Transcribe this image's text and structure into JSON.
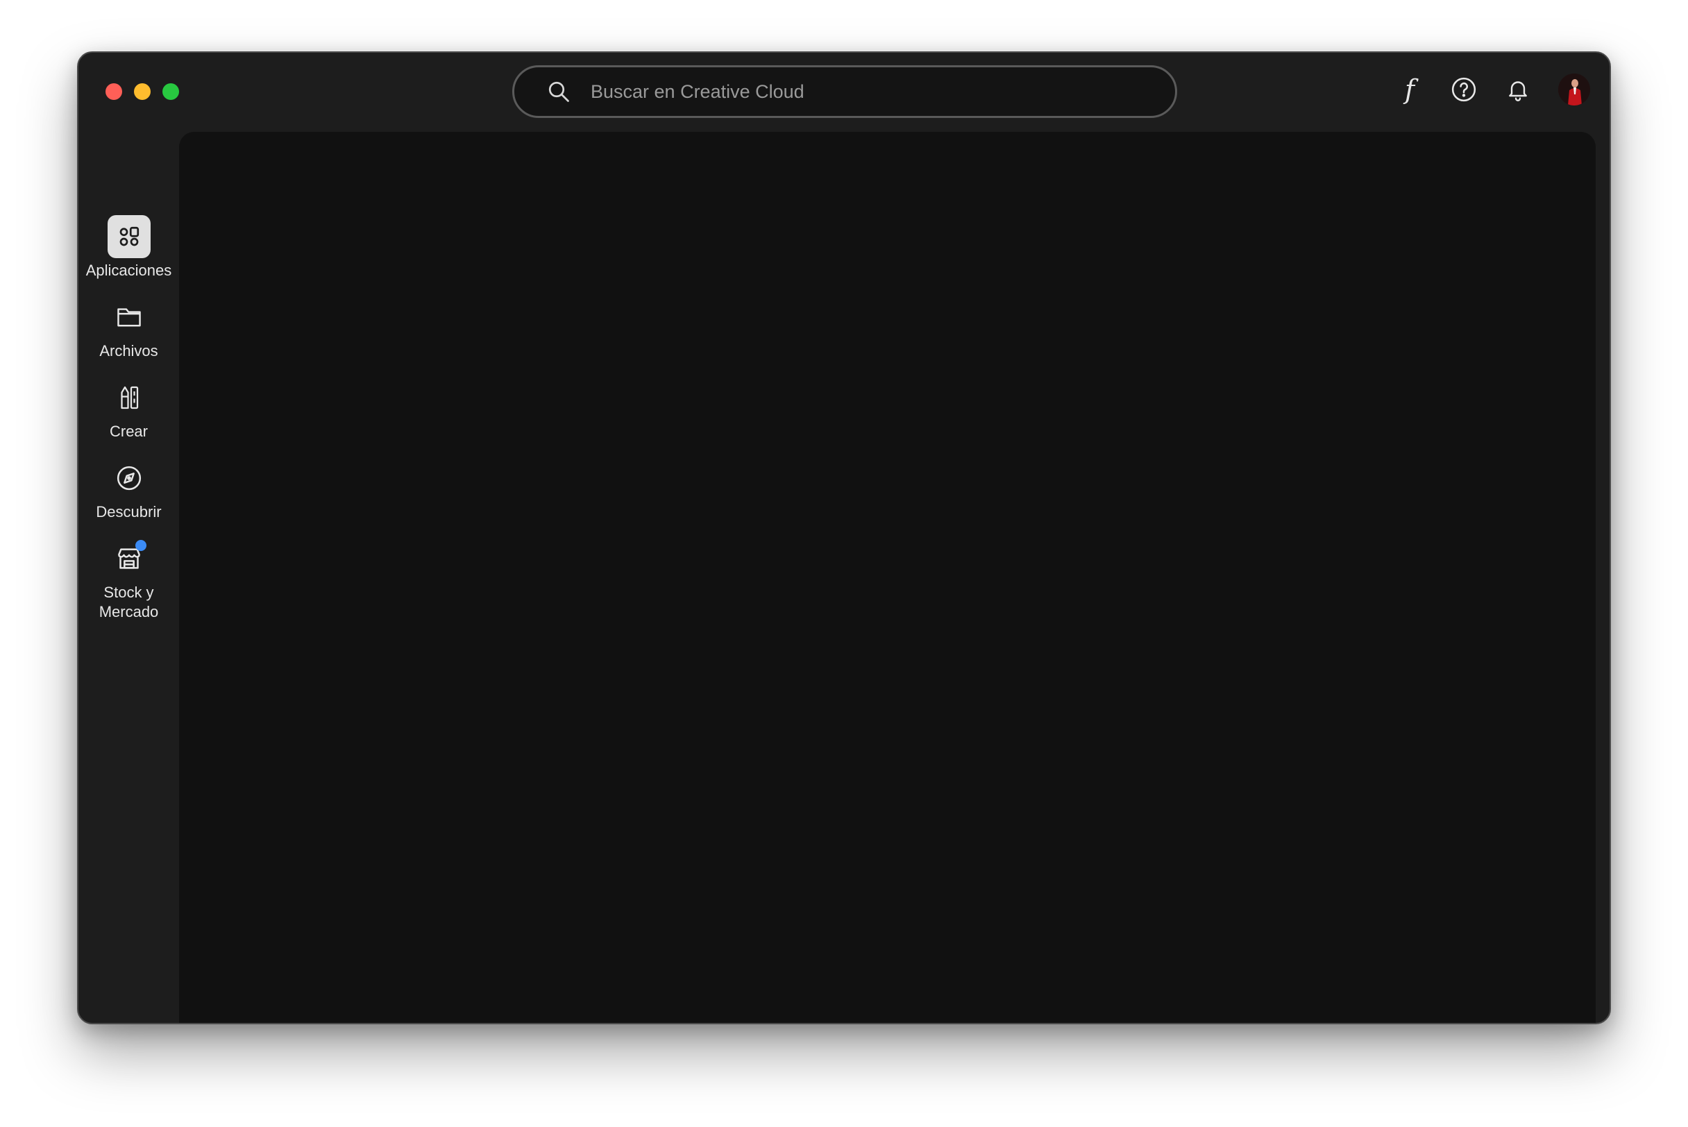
{
  "window": {
    "traffic_lights": {
      "close_color": "#ff5f57",
      "minimize_color": "#febc2e",
      "maximize_color": "#28c840"
    }
  },
  "search": {
    "placeholder": "Buscar en Creative Cloud",
    "value": "",
    "icon": "search-icon"
  },
  "toolbar": {
    "fonts_label": "f",
    "icons": [
      "fonts-icon",
      "help-icon",
      "bell-icon",
      "avatar"
    ]
  },
  "sidebar": {
    "items": [
      {
        "label": "Aplicaciones",
        "icon": "apps-grid-icon",
        "active": true
      },
      {
        "label": "Archivos",
        "icon": "folder-icon",
        "active": false
      },
      {
        "label": "Crear",
        "icon": "pencils-icon",
        "active": false
      },
      {
        "label": "Descubrir",
        "icon": "compass-icon",
        "active": false
      },
      {
        "label": "Stock y\nMercado",
        "icon": "storefront-icon",
        "active": false,
        "badge": true
      }
    ]
  },
  "colors": {
    "window_bg": "#1d1d1d",
    "content_bg": "#111111",
    "active_nav_bg": "#e0e0e0",
    "badge_blue": "#3b8bf5",
    "text": "#e8e8e8"
  }
}
